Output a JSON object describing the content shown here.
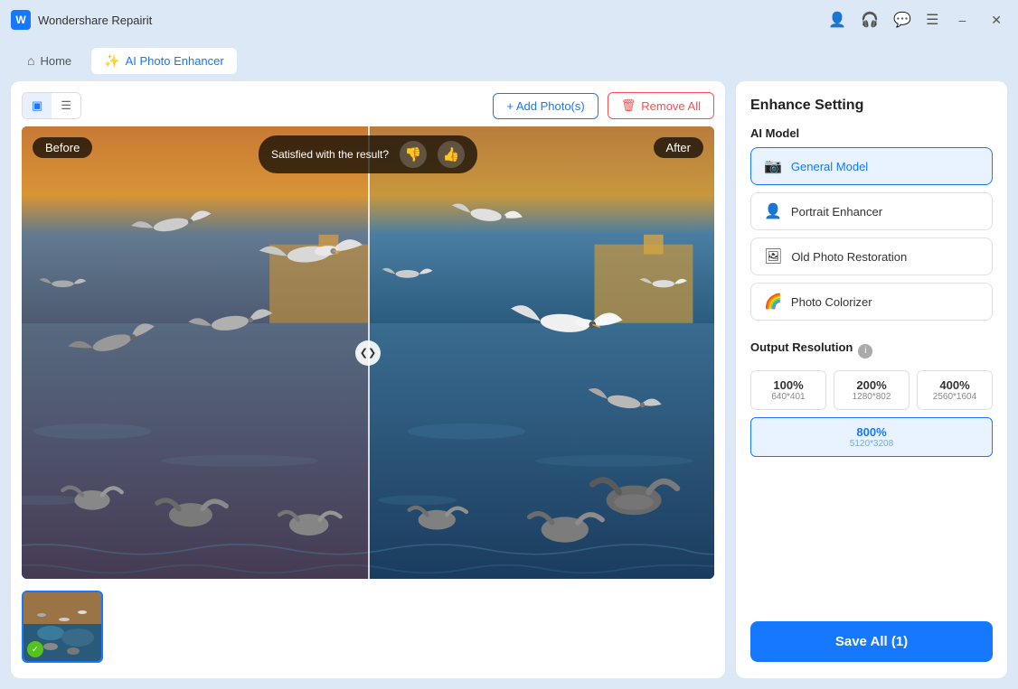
{
  "titlebar": {
    "app_name": "Wondershare Repairit",
    "icons": [
      "account-icon",
      "headphone-icon",
      "chat-icon",
      "menu-icon",
      "minimize-icon",
      "close-icon"
    ]
  },
  "navbar": {
    "home_tab": "Home",
    "active_tab": "AI Photo Enhancer"
  },
  "toolbar": {
    "add_photos_label": "+ Add Photo(s)",
    "remove_all_label": "Remove All"
  },
  "image_view": {
    "before_label": "Before",
    "after_label": "After",
    "feedback_text": "Satisfied with the result?",
    "thumbs_down": "👎",
    "thumbs_up": "👍"
  },
  "enhance_setting": {
    "title": "Enhance Setting",
    "ai_model_label": "AI Model",
    "models": [
      {
        "name": "General Model",
        "selected": true
      },
      {
        "name": "Portrait Enhancer",
        "selected": false
      },
      {
        "name": "Old Photo Restoration",
        "selected": false
      },
      {
        "name": "Photo Colorizer",
        "selected": false
      }
    ],
    "output_resolution_label": "Output Resolution",
    "resolutions": [
      {
        "pct": "100%",
        "dim": "640*401",
        "selected": false
      },
      {
        "pct": "200%",
        "dim": "1280*802",
        "selected": false
      },
      {
        "pct": "400%",
        "dim": "2560*1604",
        "selected": false
      },
      {
        "pct": "800%",
        "dim": "5120*3208",
        "selected": true
      }
    ],
    "save_button": "Save All (1)"
  }
}
